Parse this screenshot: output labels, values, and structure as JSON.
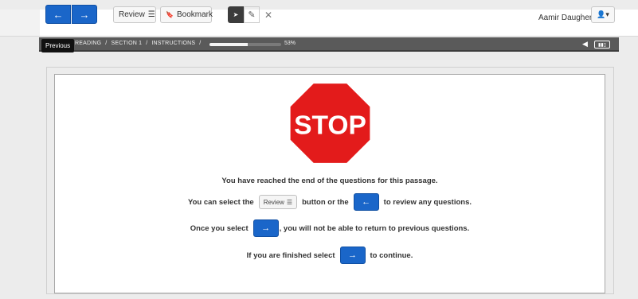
{
  "toolbar": {
    "prev_glyph": "←",
    "next_glyph": "→",
    "review_label": "Review",
    "review_icon_glyph": "☰",
    "bookmark_label": "Bookmark",
    "bookmark_icon_glyph": "🔖",
    "pointer_glyph": "➤",
    "note_glyph": "✎",
    "close_glyph": "✕",
    "user_name": "Aamir Daugherty",
    "user_icon_glyph": "👤▾"
  },
  "breadcrumb": {
    "items": [
      "READING",
      "/",
      "SECTION 1",
      "/",
      "INSTRUCTIONS",
      "/"
    ],
    "progress_percent": 53,
    "progress_label": "53%",
    "speaker_glyph": "◀",
    "battery_label": "▮▮▯"
  },
  "tooltip": {
    "text": "Previous"
  },
  "content": {
    "stop_text": "STOP",
    "line1": "You have reached the end of the questions for this passage.",
    "line2_before": "You can select the",
    "line2_review": "Review",
    "line2_middle": "button or the",
    "line2_after": "to review any questions.",
    "line3_before": "Once you select",
    "line3_after": ", you will not be able to return to previous questions.",
    "line4_before": "If you are finished select",
    "line4_after": "to continue."
  },
  "colors": {
    "accent": "#1a66c9",
    "stop_red": "#e31b1b",
    "bar": "#5a5a5a"
  }
}
